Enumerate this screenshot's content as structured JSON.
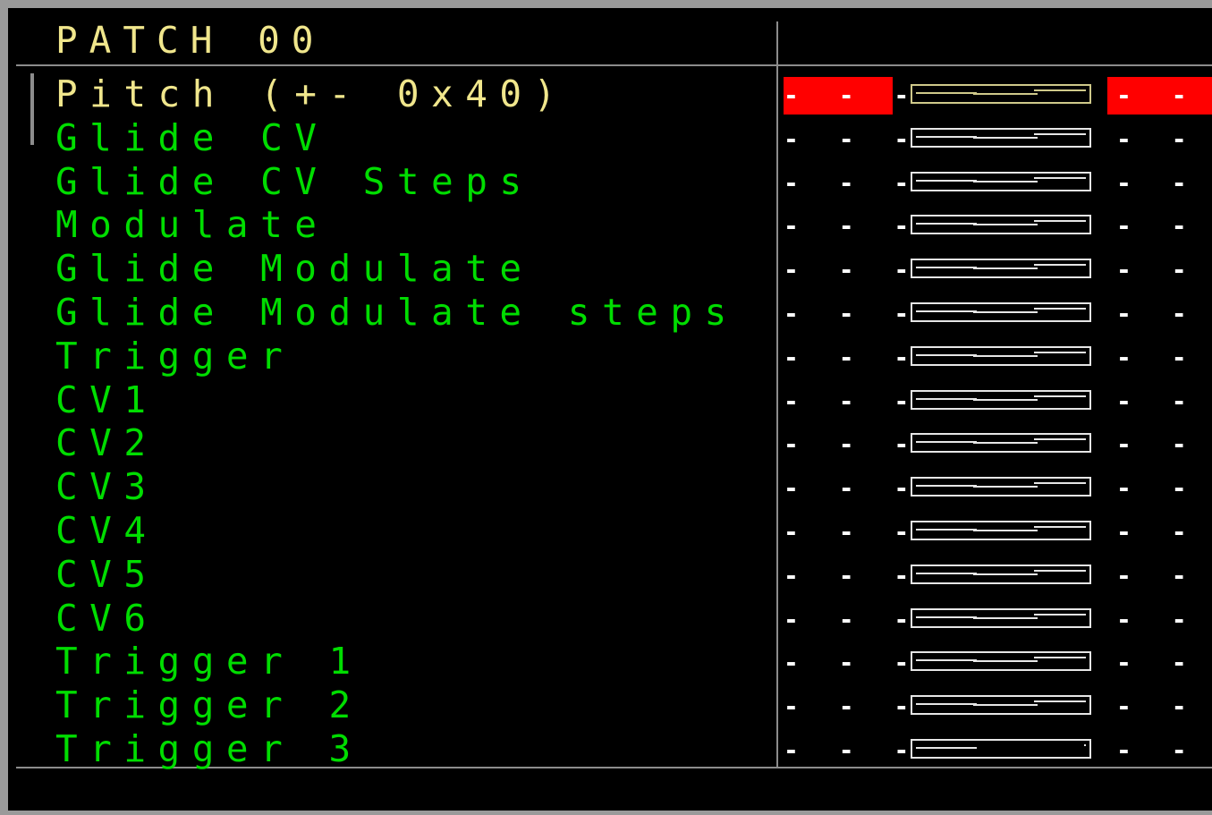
{
  "header": {
    "title": "PATCH 00"
  },
  "colors": {
    "selected_text": "#f0e68c",
    "param_text": "#00dd00",
    "active_marker": "#ff0000",
    "frame": "#9a9a9a"
  },
  "params": [
    {
      "label": "Pitch (+- 0x40)",
      "left": "- - -",
      "right": "- - -",
      "selected": true,
      "level": 0.5
    },
    {
      "label": "Glide CV",
      "left": "- - -",
      "right": "- - -",
      "selected": false,
      "level": 0.5
    },
    {
      "label": "Glide CV Steps",
      "left": "- - -",
      "right": "- - -",
      "selected": false,
      "level": 0.5
    },
    {
      "label": "Modulate",
      "left": "- - -",
      "right": "- - -",
      "selected": false,
      "level": 0.5
    },
    {
      "label": "Glide Modulate",
      "left": "- - -",
      "right": "- - -",
      "selected": false,
      "level": 0.5
    },
    {
      "label": "Glide Modulate steps",
      "left": "- - -",
      "right": "- - -",
      "selected": false,
      "level": 0.5
    },
    {
      "label": "Trigger",
      "left": "- - -",
      "right": "- - -",
      "selected": false,
      "level": 0.5
    },
    {
      "label": "CV1",
      "left": "- - -",
      "right": "- - -",
      "selected": false,
      "level": 0.5
    },
    {
      "label": "CV2",
      "left": "- - -",
      "right": "- - -",
      "selected": false,
      "level": 0.5
    },
    {
      "label": "CV3",
      "left": "- - -",
      "right": "- - -",
      "selected": false,
      "level": 0.5
    },
    {
      "label": "CV4",
      "left": "- - -",
      "right": "- - -",
      "selected": false,
      "level": 0.5
    },
    {
      "label": "CV5",
      "left": "- - -",
      "right": "- - -",
      "selected": false,
      "level": 0.5
    },
    {
      "label": "CV6",
      "left": "- - -",
      "right": "- - -",
      "selected": false,
      "level": 0.5
    },
    {
      "label": "Trigger 1",
      "left": "- - -",
      "right": "- - -",
      "selected": false,
      "level": 0.5
    },
    {
      "label": "Trigger 2",
      "left": "- - -",
      "right": "- - -",
      "selected": false,
      "level": 0.5
    },
    {
      "label": "Trigger 3",
      "left": "- - -",
      "right": "- - -",
      "selected": false,
      "level": 0.0
    }
  ]
}
